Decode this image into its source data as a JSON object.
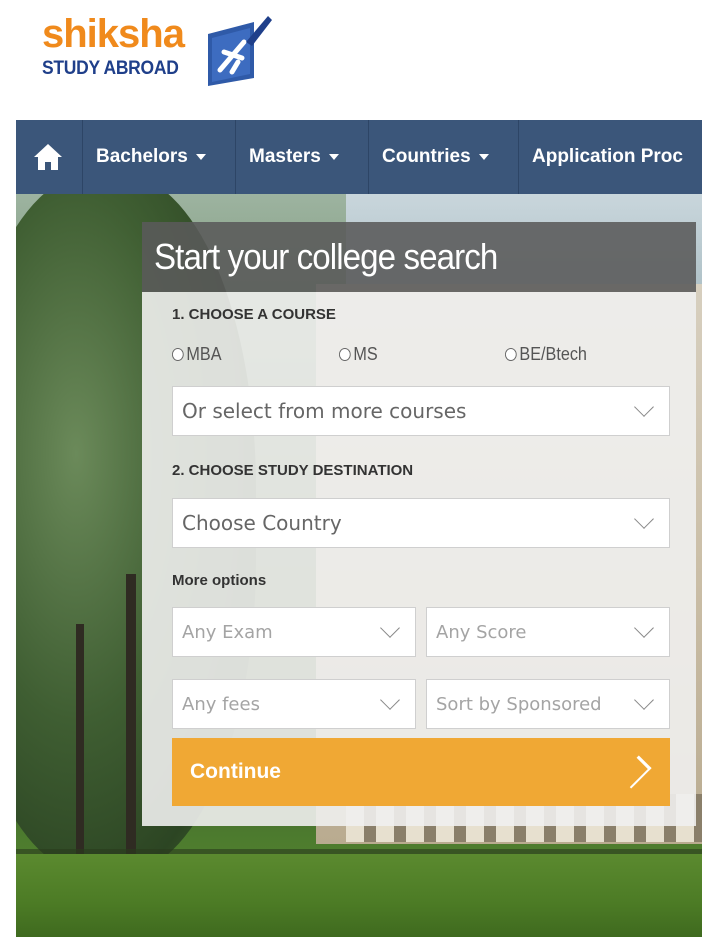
{
  "logo": {
    "word": "shiksha",
    "subtitle": "STUDY ABROAD"
  },
  "nav": {
    "items": [
      {
        "label": "Bachelors",
        "has_caret": true
      },
      {
        "label": "Masters",
        "has_caret": true
      },
      {
        "label": "Countries",
        "has_caret": true
      },
      {
        "label": "Application Proc",
        "has_caret": false
      }
    ],
    "background_color": "#3b567a"
  },
  "search": {
    "title": "Start your college search",
    "step1_label": "1. CHOOSE A COURSE",
    "course_options": [
      "MBA",
      "MS",
      "BE/Btech"
    ],
    "more_courses_placeholder": "Or select from more courses",
    "step2_label": "2. CHOOSE STUDY DESTINATION",
    "country_placeholder": "Choose Country",
    "more_options_label": "More options",
    "exam_placeholder": "Any Exam",
    "score_placeholder": "Any Score",
    "fees_placeholder": "Any fees",
    "sort_placeholder": "Sort by Sponsored",
    "continue_label": "Continue",
    "accent_color": "#f0a834"
  }
}
